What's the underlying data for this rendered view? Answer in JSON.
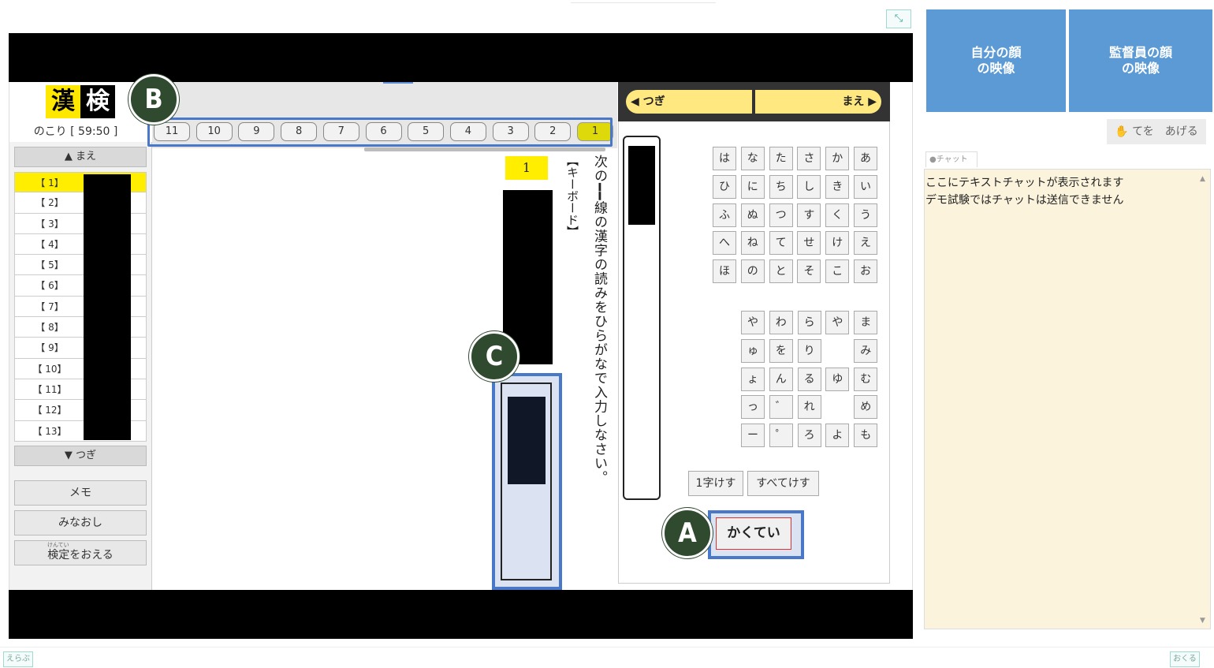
{
  "window": {
    "expand_icon": "expand-icon"
  },
  "logo": {
    "char1": "漢",
    "char2": "検"
  },
  "timer": {
    "text": "のこり [ 59:50 ]"
  },
  "sidebar": {
    "prev_label": "▲ まえ",
    "next_label": "▼ つぎ",
    "items": [
      {
        "label": "【 1】"
      },
      {
        "label": "【 2】"
      },
      {
        "label": "【 3】"
      },
      {
        "label": "【 4】"
      },
      {
        "label": "【 5】"
      },
      {
        "label": "【 6】"
      },
      {
        "label": "【 7】"
      },
      {
        "label": "【 8】"
      },
      {
        "label": "【 9】"
      },
      {
        "label": "【 10】"
      },
      {
        "label": "【 11】"
      },
      {
        "label": "【 12】"
      },
      {
        "label": "【 13】"
      }
    ],
    "memo_label": "メモ",
    "review_label": "みなおし",
    "finish_ruby": "けんてい",
    "finish_label": "検定をおえる"
  },
  "question_tabs": [
    "11",
    "10",
    "9",
    "8",
    "7",
    "6",
    "5",
    "4",
    "3",
    "2",
    "1"
  ],
  "question": {
    "number": "1",
    "instruction": "次の━━線の漢字の読みをひらがなで入力しなさい。",
    "keyboard_note": "【キーボード】"
  },
  "keyboard": {
    "next_label": "◀ つぎ",
    "prev_label": "まえ ▶",
    "rows1": [
      [
        "は",
        "な",
        "た",
        "さ",
        "か",
        "あ"
      ],
      [
        "ひ",
        "に",
        "ち",
        "し",
        "き",
        "い"
      ],
      [
        "ふ",
        "ぬ",
        "つ",
        "す",
        "く",
        "う"
      ],
      [
        "へ",
        "ね",
        "て",
        "せ",
        "け",
        "え"
      ],
      [
        "ほ",
        "の",
        "と",
        "そ",
        "こ",
        "お"
      ]
    ],
    "rows2": [
      [
        "や",
        "わ",
        "ら",
        "や",
        "ま"
      ],
      [
        "ゅ",
        "を",
        "り",
        "",
        "み"
      ],
      [
        "ょ",
        "ん",
        "る",
        "ゆ",
        "む"
      ],
      [
        "っ",
        "゛",
        "れ",
        "",
        "め"
      ],
      [
        "ー",
        "゜",
        "ろ",
        "よ",
        "も"
      ]
    ],
    "delete_one_label": "1字けす",
    "delete_all_label": "すべてけす",
    "confirm_label": "かくてい"
  },
  "callouts": {
    "a": "A",
    "b": "B",
    "c": "C"
  },
  "video": {
    "self_label": "自分の顔\nの映像",
    "proctor_label": "監督員の顔\nの映像"
  },
  "raise_hand": {
    "label": "てを　あげる",
    "icon": "hand-icon"
  },
  "chat": {
    "tab_label": "チャット",
    "lines": [
      "ここにテキストチャットが表示されます",
      "デモ試験ではチャットは送信できません"
    ]
  },
  "footer": {
    "left_label": "えらぶ",
    "right_label": "おくる"
  },
  "colors": {
    "accent_blue": "#4a78c8",
    "highlight_yellow": "#ffee00",
    "badge_green": "#2f4a2f",
    "video_blue": "#5b9ad5"
  }
}
